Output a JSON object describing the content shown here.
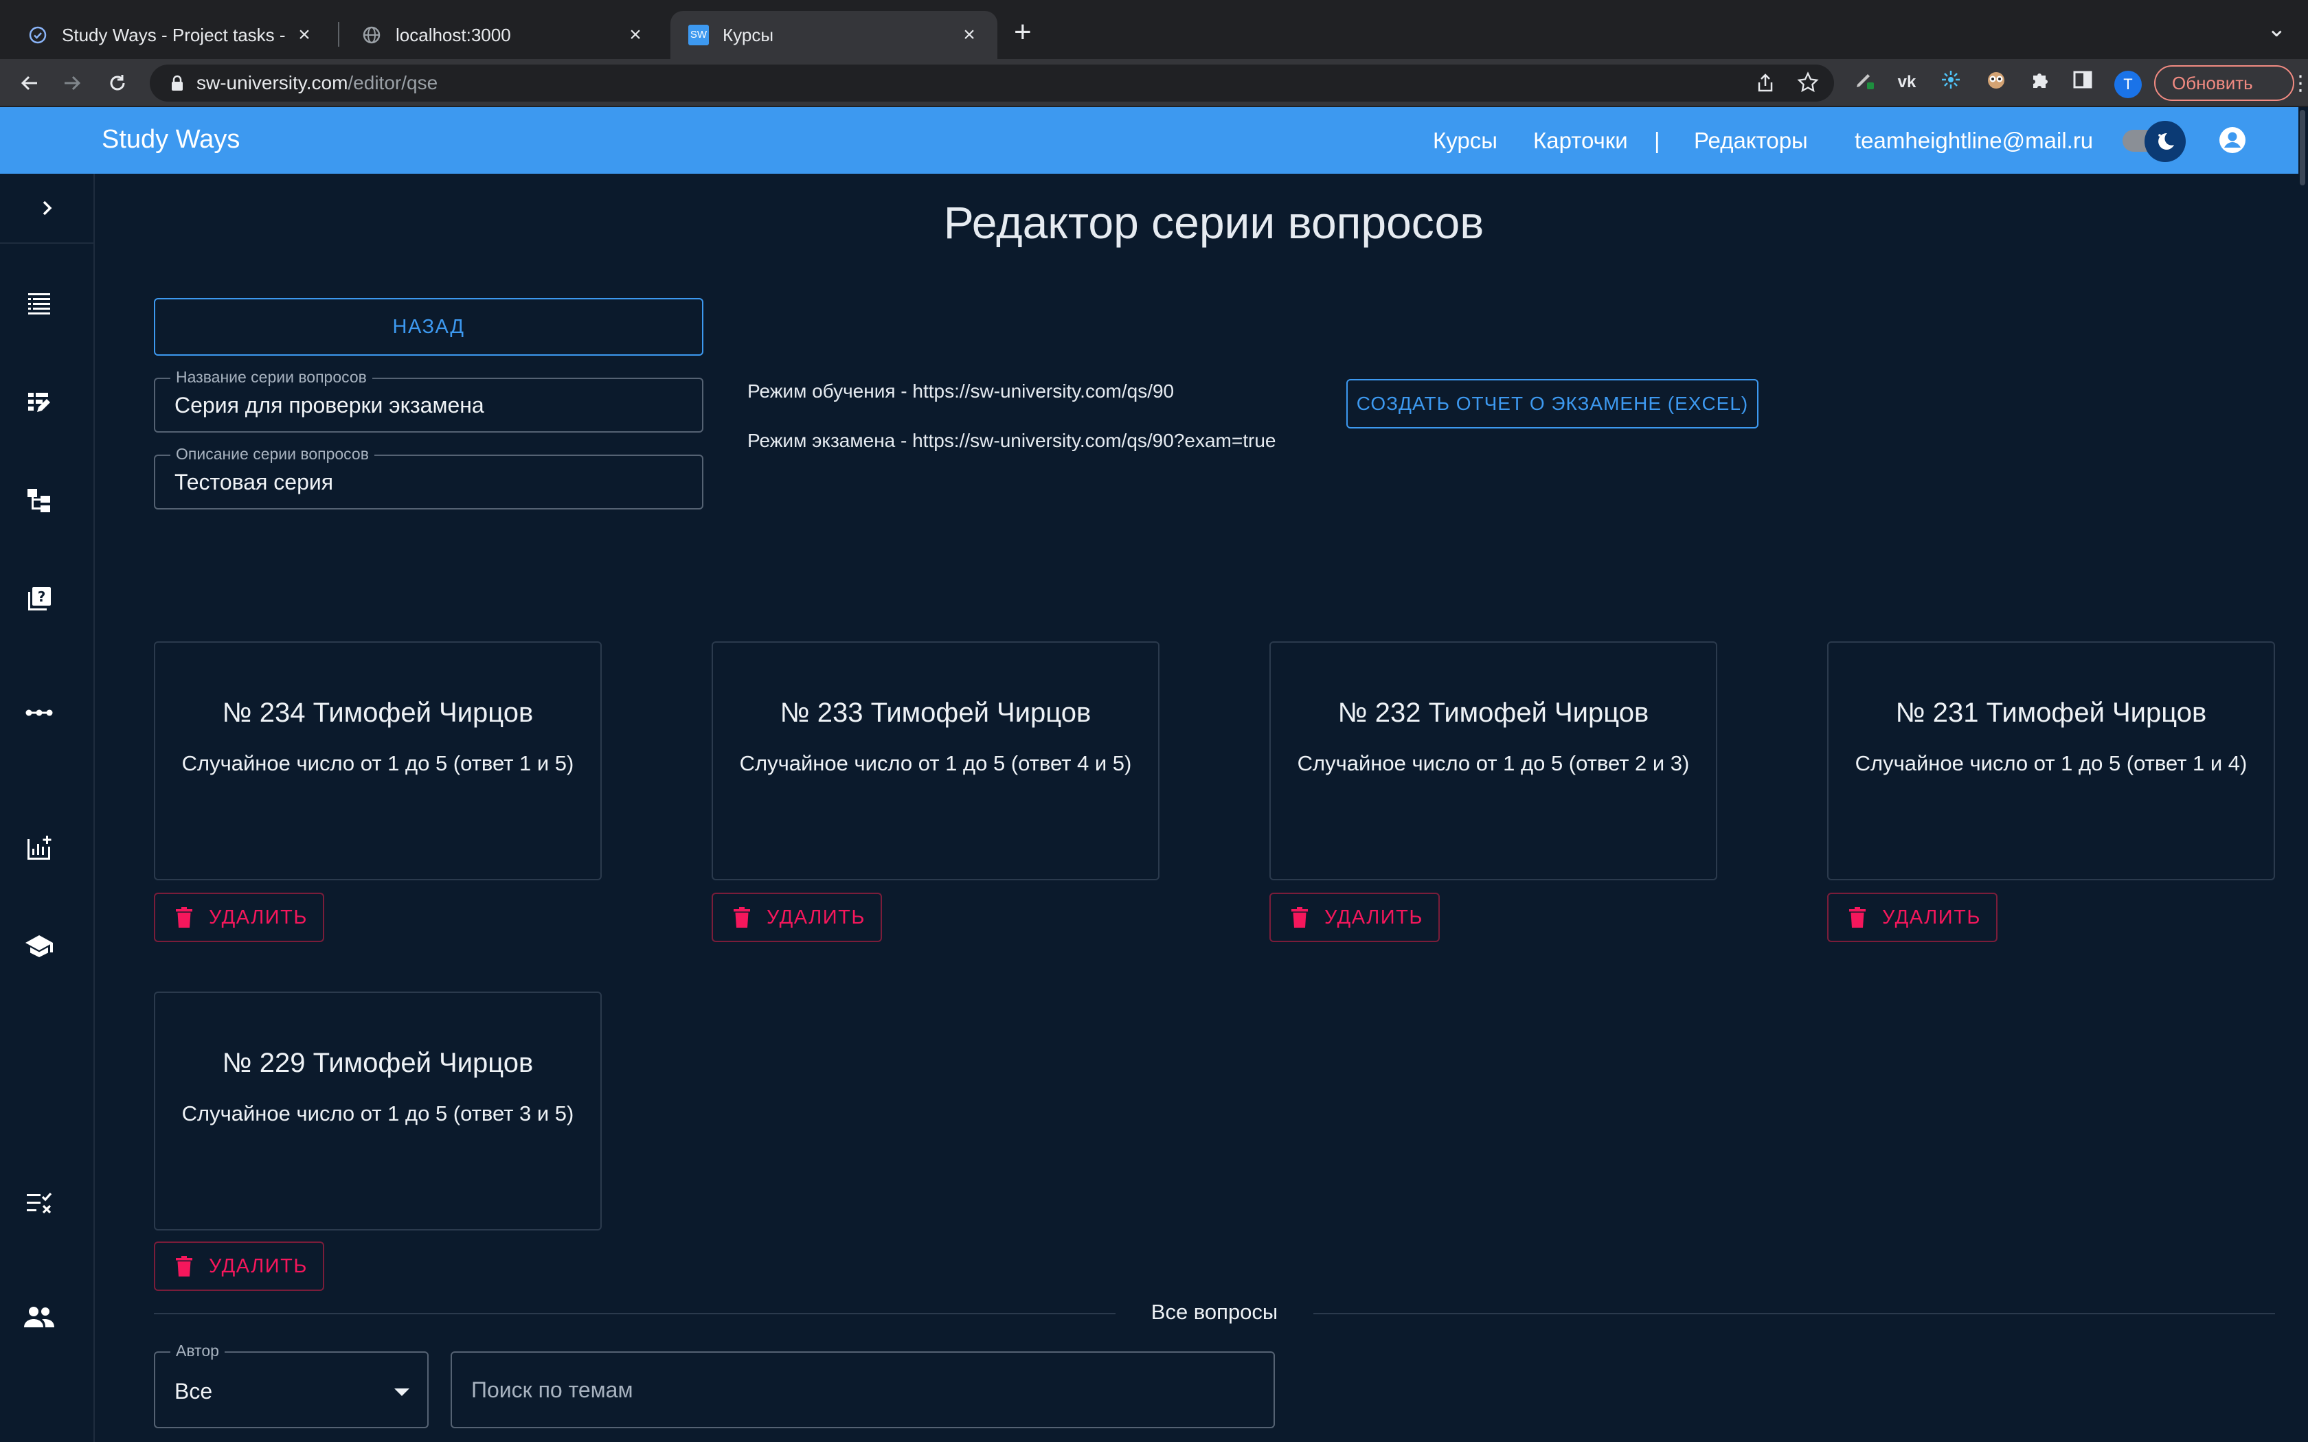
{
  "browser": {
    "tabs": [
      {
        "title": "Study Ways - Project tasks - W",
        "icon": "task-check-icon"
      },
      {
        "title": "localhost:3000",
        "icon": "globe-icon"
      },
      {
        "title": "Курсы",
        "icon": "sw-favicon",
        "favicon_text": "SW"
      }
    ],
    "url_host": "sw-university.com",
    "url_path": "/editor/qse",
    "profile_initial": "T",
    "update_label": "Обновить",
    "colors": {
      "chrome_bg": "#202124",
      "tab_active": "#35363a",
      "update_accent": "#f28b82"
    }
  },
  "header": {
    "brand": "Study Ways",
    "nav": {
      "courses": "Курсы",
      "cards": "Карточки",
      "separator": "|",
      "editors": "Редакторы",
      "email": "teamheightline@mail.ru"
    },
    "colors": {
      "appbar": "#3d99f0"
    }
  },
  "sidebar": {
    "items": [
      "chevron-right-icon",
      "list-icon",
      "edit-list-icon",
      "tree-icon",
      "quiz-icon",
      "more-horiz-icon",
      "add-chart-icon",
      "school-icon",
      "checklist-icon",
      "people-icon"
    ]
  },
  "main": {
    "title": "Редактор серии вопросов",
    "back_label": "НАЗАД",
    "name_field": {
      "label": "Название серии вопросов",
      "value": "Серия для проверки экзамена"
    },
    "description_field": {
      "label": "Описание серии вопросов",
      "value": "Тестовая серия"
    },
    "learning_mode": "Режим обучения - https://sw-university.com/qs/90",
    "exam_mode": "Режим экзамена - https://sw-university.com/qs/90?exam=true",
    "report_label": "СОЗДАТЬ ОТЧЕТ О ЭКЗАМЕНЕ (EXCEL)",
    "delete_label": "УДАЛИТЬ",
    "questions": [
      {
        "title": "№ 234 Тимофей Чирцов",
        "desc": "Случайное число от 1 до 5 (ответ 1 и 5)"
      },
      {
        "title": "№ 233 Тимофей Чирцов",
        "desc": "Случайное число от 1 до 5 (ответ 4 и 5)"
      },
      {
        "title": "№ 232 Тимофей Чирцов",
        "desc": "Случайное число от 1 до 5 (ответ 2 и 3)"
      },
      {
        "title": "№ 231 Тимофей Чирцов",
        "desc": "Случайное число от 1 до 5 (ответ 1 и 4)"
      },
      {
        "title": "№ 229 Тимофей Чирцов",
        "desc": "Случайное число от 1 до 5 (ответ 3 и 5)"
      }
    ],
    "all_questions_label": "Все вопросы",
    "author_filter": {
      "label": "Автор",
      "value": "Все"
    },
    "search": {
      "placeholder": "Поиск по темам"
    },
    "colors": {
      "bg": "#0b1a2c",
      "accent": "#3d99f0",
      "danger": "#f5175c"
    }
  }
}
